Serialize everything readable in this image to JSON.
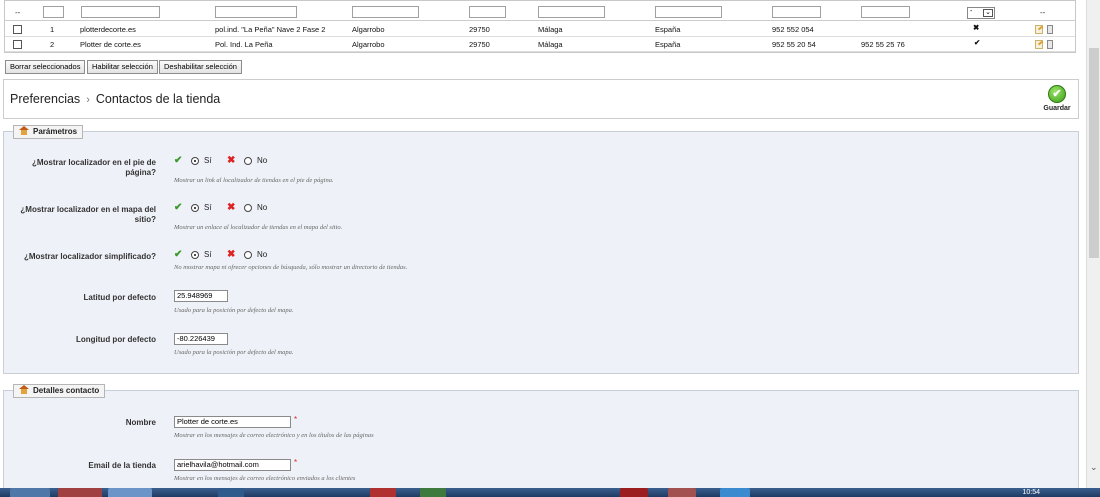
{
  "filters": {
    "left_dash": "--",
    "right_dash": "--",
    "select_value": "-"
  },
  "rows": [
    {
      "id": "1",
      "name": "plotterdecorte.es",
      "address": "pol.ind. \"La Peña\" Nave 2 Fase 2",
      "city": "Algarrobo",
      "postcode": "29750",
      "province": "Málaga",
      "country": "España",
      "phone": "952 552 054",
      "fax": "",
      "active": false
    },
    {
      "id": "2",
      "name": "Plotter de corte.es",
      "address": "Pol. Ind. La Peña",
      "city": "Algarrobo",
      "postcode": "29750",
      "province": "Málaga",
      "country": "España",
      "phone": "952 55 20 54",
      "fax": "952 55 25 76",
      "active": true
    }
  ],
  "bulk": {
    "delete": "Borrar seleccionados",
    "enable": "Habilitar selección",
    "disable": "Deshabilitar selección"
  },
  "breadcrumb": {
    "parent": "Preferencias",
    "separator": "›",
    "current": "Contactos de la tienda"
  },
  "save": {
    "label": "Guardar"
  },
  "params": {
    "legend": "Parámetros",
    "footer_locator": {
      "label": "¿Mostrar localizador en el pie de página?",
      "yes": "Sí",
      "no": "No",
      "hint": "Mostrar un link al localizador de tiendas en el pie de página."
    },
    "sitemap_locator": {
      "label": "¿Mostrar localizador en el mapa del sitio?",
      "yes": "Sí",
      "no": "No",
      "hint": "Mostrar un enlace al localizador de tiendas en el mapa del sitio."
    },
    "simple_locator": {
      "label": "¿Mostrar localizador simplificado?",
      "yes": "Sí",
      "no": "No",
      "hint": "No mostrar mapa ni ofrecer opciones de búsqueda, sólo mostrar un directorio de tiendas."
    },
    "latitude": {
      "label": "Latitud por defecto",
      "value": "25.948969",
      "hint": "Usado para la posición por defecto del mapa."
    },
    "longitude": {
      "label": "Longitud por defecto",
      "value": "-80.226439",
      "hint": "Usado para la posición por defecto del mapa."
    }
  },
  "contact": {
    "legend": "Detalles contacto",
    "name": {
      "label": "Nombre",
      "value": "Plotter de corte.es",
      "hint": "Mostrar en los mensajes de correo electrónico y en los títulos de las páginas"
    },
    "email": {
      "label": "Email de la tienda",
      "value": "arielhavila@hotmail.com",
      "hint": "Mostrar en los mensajes de correo electrónico enviados a los clientes"
    },
    "required": "*"
  },
  "taskbar": {
    "time": "10:54"
  },
  "colors": {
    "panel_bg": "#eef1f7",
    "accent_green": "#3b9d16",
    "error_red": "#d22222"
  }
}
